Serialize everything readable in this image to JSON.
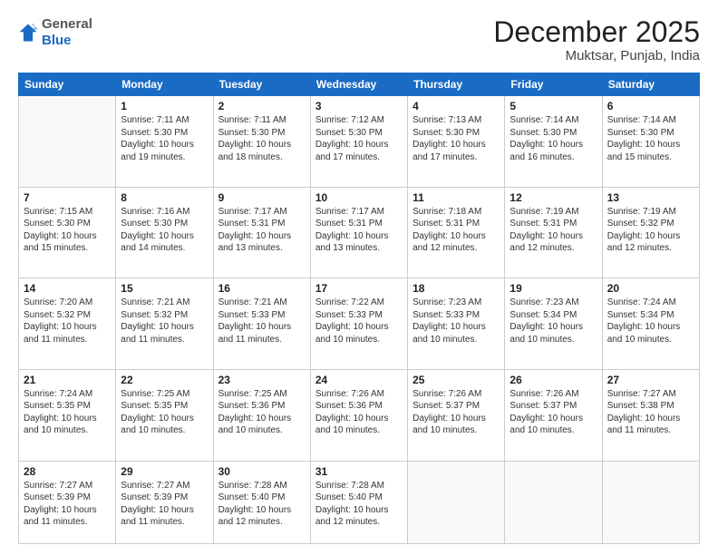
{
  "logo": {
    "general": "General",
    "blue": "Blue"
  },
  "header": {
    "month": "December 2025",
    "location": "Muktsar, Punjab, India"
  },
  "weekdays": [
    "Sunday",
    "Monday",
    "Tuesday",
    "Wednesday",
    "Thursday",
    "Friday",
    "Saturday"
  ],
  "weeks": [
    [
      {
        "day": "",
        "info": ""
      },
      {
        "day": "1",
        "info": "Sunrise: 7:11 AM\nSunset: 5:30 PM\nDaylight: 10 hours\nand 19 minutes."
      },
      {
        "day": "2",
        "info": "Sunrise: 7:11 AM\nSunset: 5:30 PM\nDaylight: 10 hours\nand 18 minutes."
      },
      {
        "day": "3",
        "info": "Sunrise: 7:12 AM\nSunset: 5:30 PM\nDaylight: 10 hours\nand 17 minutes."
      },
      {
        "day": "4",
        "info": "Sunrise: 7:13 AM\nSunset: 5:30 PM\nDaylight: 10 hours\nand 17 minutes."
      },
      {
        "day": "5",
        "info": "Sunrise: 7:14 AM\nSunset: 5:30 PM\nDaylight: 10 hours\nand 16 minutes."
      },
      {
        "day": "6",
        "info": "Sunrise: 7:14 AM\nSunset: 5:30 PM\nDaylight: 10 hours\nand 15 minutes."
      }
    ],
    [
      {
        "day": "7",
        "info": "Sunrise: 7:15 AM\nSunset: 5:30 PM\nDaylight: 10 hours\nand 15 minutes."
      },
      {
        "day": "8",
        "info": "Sunrise: 7:16 AM\nSunset: 5:30 PM\nDaylight: 10 hours\nand 14 minutes."
      },
      {
        "day": "9",
        "info": "Sunrise: 7:17 AM\nSunset: 5:31 PM\nDaylight: 10 hours\nand 13 minutes."
      },
      {
        "day": "10",
        "info": "Sunrise: 7:17 AM\nSunset: 5:31 PM\nDaylight: 10 hours\nand 13 minutes."
      },
      {
        "day": "11",
        "info": "Sunrise: 7:18 AM\nSunset: 5:31 PM\nDaylight: 10 hours\nand 12 minutes."
      },
      {
        "day": "12",
        "info": "Sunrise: 7:19 AM\nSunset: 5:31 PM\nDaylight: 10 hours\nand 12 minutes."
      },
      {
        "day": "13",
        "info": "Sunrise: 7:19 AM\nSunset: 5:32 PM\nDaylight: 10 hours\nand 12 minutes."
      }
    ],
    [
      {
        "day": "14",
        "info": "Sunrise: 7:20 AM\nSunset: 5:32 PM\nDaylight: 10 hours\nand 11 minutes."
      },
      {
        "day": "15",
        "info": "Sunrise: 7:21 AM\nSunset: 5:32 PM\nDaylight: 10 hours\nand 11 minutes."
      },
      {
        "day": "16",
        "info": "Sunrise: 7:21 AM\nSunset: 5:33 PM\nDaylight: 10 hours\nand 11 minutes."
      },
      {
        "day": "17",
        "info": "Sunrise: 7:22 AM\nSunset: 5:33 PM\nDaylight: 10 hours\nand 10 minutes."
      },
      {
        "day": "18",
        "info": "Sunrise: 7:23 AM\nSunset: 5:33 PM\nDaylight: 10 hours\nand 10 minutes."
      },
      {
        "day": "19",
        "info": "Sunrise: 7:23 AM\nSunset: 5:34 PM\nDaylight: 10 hours\nand 10 minutes."
      },
      {
        "day": "20",
        "info": "Sunrise: 7:24 AM\nSunset: 5:34 PM\nDaylight: 10 hours\nand 10 minutes."
      }
    ],
    [
      {
        "day": "21",
        "info": "Sunrise: 7:24 AM\nSunset: 5:35 PM\nDaylight: 10 hours\nand 10 minutes."
      },
      {
        "day": "22",
        "info": "Sunrise: 7:25 AM\nSunset: 5:35 PM\nDaylight: 10 hours\nand 10 minutes."
      },
      {
        "day": "23",
        "info": "Sunrise: 7:25 AM\nSunset: 5:36 PM\nDaylight: 10 hours\nand 10 minutes."
      },
      {
        "day": "24",
        "info": "Sunrise: 7:26 AM\nSunset: 5:36 PM\nDaylight: 10 hours\nand 10 minutes."
      },
      {
        "day": "25",
        "info": "Sunrise: 7:26 AM\nSunset: 5:37 PM\nDaylight: 10 hours\nand 10 minutes."
      },
      {
        "day": "26",
        "info": "Sunrise: 7:26 AM\nSunset: 5:37 PM\nDaylight: 10 hours\nand 10 minutes."
      },
      {
        "day": "27",
        "info": "Sunrise: 7:27 AM\nSunset: 5:38 PM\nDaylight: 10 hours\nand 11 minutes."
      }
    ],
    [
      {
        "day": "28",
        "info": "Sunrise: 7:27 AM\nSunset: 5:39 PM\nDaylight: 10 hours\nand 11 minutes."
      },
      {
        "day": "29",
        "info": "Sunrise: 7:27 AM\nSunset: 5:39 PM\nDaylight: 10 hours\nand 11 minutes."
      },
      {
        "day": "30",
        "info": "Sunrise: 7:28 AM\nSunset: 5:40 PM\nDaylight: 10 hours\nand 12 minutes."
      },
      {
        "day": "31",
        "info": "Sunrise: 7:28 AM\nSunset: 5:40 PM\nDaylight: 10 hours\nand 12 minutes."
      },
      {
        "day": "",
        "info": ""
      },
      {
        "day": "",
        "info": ""
      },
      {
        "day": "",
        "info": ""
      }
    ]
  ]
}
